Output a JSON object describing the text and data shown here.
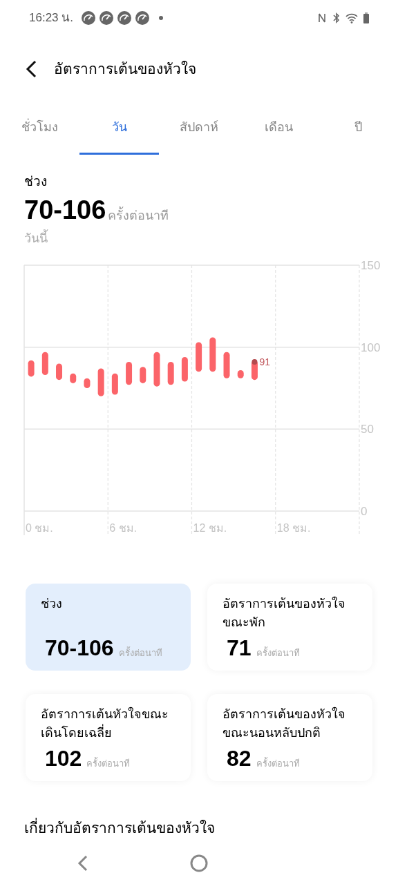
{
  "status_bar": {
    "time": "16:23 น."
  },
  "header": {
    "title": "อัตราการเต้นของหัวใจ"
  },
  "tabs": [
    {
      "label": "ชั่วโมง",
      "selected": false
    },
    {
      "label": "วัน",
      "selected": true
    },
    {
      "label": "สัปดาห์",
      "selected": false
    },
    {
      "label": "เดือน",
      "selected": false
    },
    {
      "label": "ปี",
      "selected": false
    }
  ],
  "summary": {
    "label": "ช่วง",
    "value": "70-106",
    "unit": "ครั้งต่อนาที",
    "date": "วันนี้"
  },
  "chart": {
    "y_labels": [
      "150",
      "100",
      "50",
      "0"
    ],
    "x_labels": [
      "0 ชม.",
      "6 ชม.",
      "12 ชม.",
      "18 ชม."
    ],
    "marker_label": "91"
  },
  "cards": [
    {
      "label": "ช่วง",
      "value": "70-106",
      "unit": "ครั้งต่อนาที",
      "selected": true
    },
    {
      "label": "อัตราการเต้นของหัวใจขณะพัก",
      "value": "71",
      "unit": "ครั้งต่อนาที",
      "selected": false
    },
    {
      "label": "อัตราการเต้นหัวใจขณะเดินโดยเฉลี่ย",
      "value": "102",
      "unit": "ครั้งต่อนาที",
      "selected": false
    },
    {
      "label": "อัตราการเต้นของหัวใจขณะนอนหลับปกติ",
      "value": "82",
      "unit": "ครั้งต่อนาที",
      "selected": false
    }
  ],
  "about": {
    "title": "เกี่ยวกับอัตราการเต้นของหัวใจ"
  }
}
